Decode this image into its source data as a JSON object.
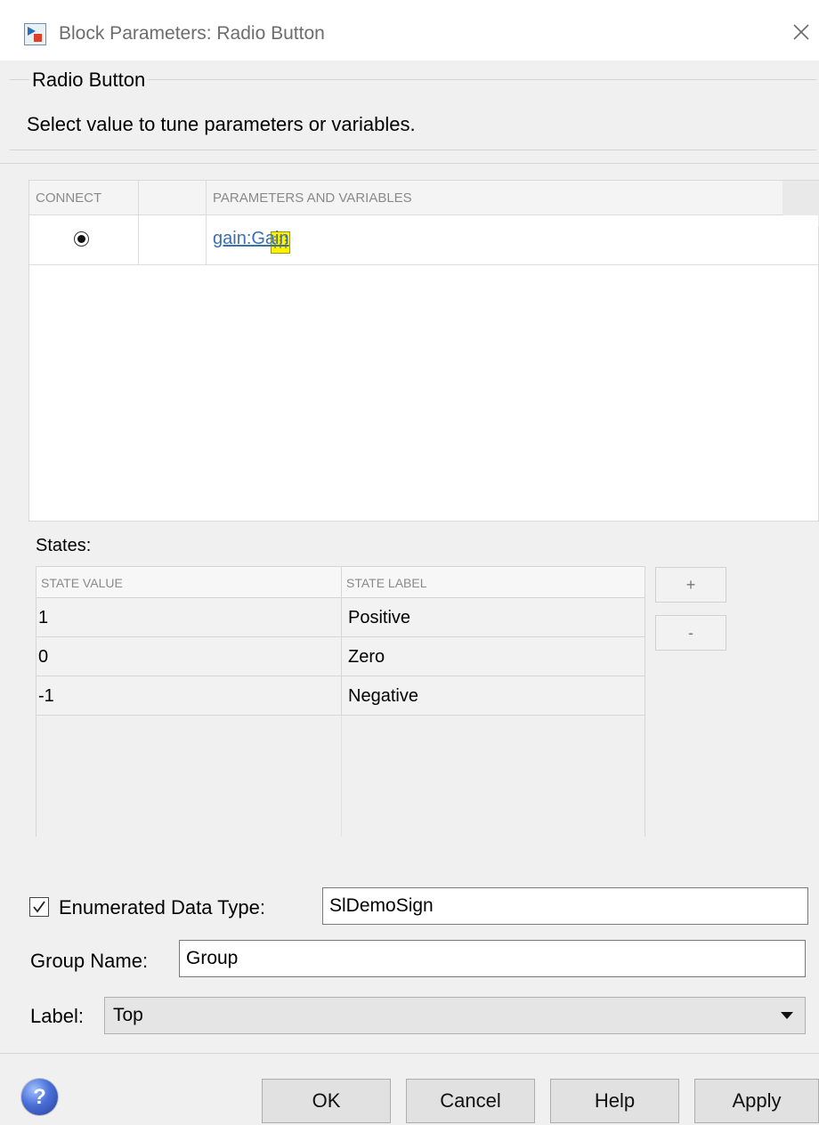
{
  "window": {
    "title": "Block Parameters: Radio Button",
    "close_glyph": "×"
  },
  "group": {
    "title": "Radio Button",
    "description": "Select value to tune parameters or variables."
  },
  "connect_table": {
    "columns": [
      "CONNECT",
      "",
      "PARAMETERS AND VARIABLES"
    ],
    "rows": [
      {
        "connected": true,
        "icon": "block-icon",
        "parameter": "gain:Gain"
      }
    ]
  },
  "states": {
    "label": "States:",
    "columns": [
      "STATE VALUE",
      "STATE LABEL"
    ],
    "rows": [
      {
        "value": "1",
        "label": "Positive"
      },
      {
        "value": "0",
        "label": "Zero"
      },
      {
        "value": "-1",
        "label": "Negative"
      }
    ],
    "add_label": "+",
    "remove_label": "-"
  },
  "enumerated": {
    "checked": true,
    "label": "Enumerated Data Type:",
    "value": "SlDemoSign"
  },
  "group_name": {
    "label": "Group Name:",
    "value": "Group"
  },
  "label_field": {
    "label": "Label:",
    "value": "Top"
  },
  "footer": {
    "ok": "OK",
    "cancel": "Cancel",
    "help": "Help",
    "apply": "Apply",
    "help_icon_glyph": "?"
  },
  "colors": {
    "link": "#3a6fb0",
    "block_icon": "#fff200",
    "background": "#f0f0f0"
  }
}
